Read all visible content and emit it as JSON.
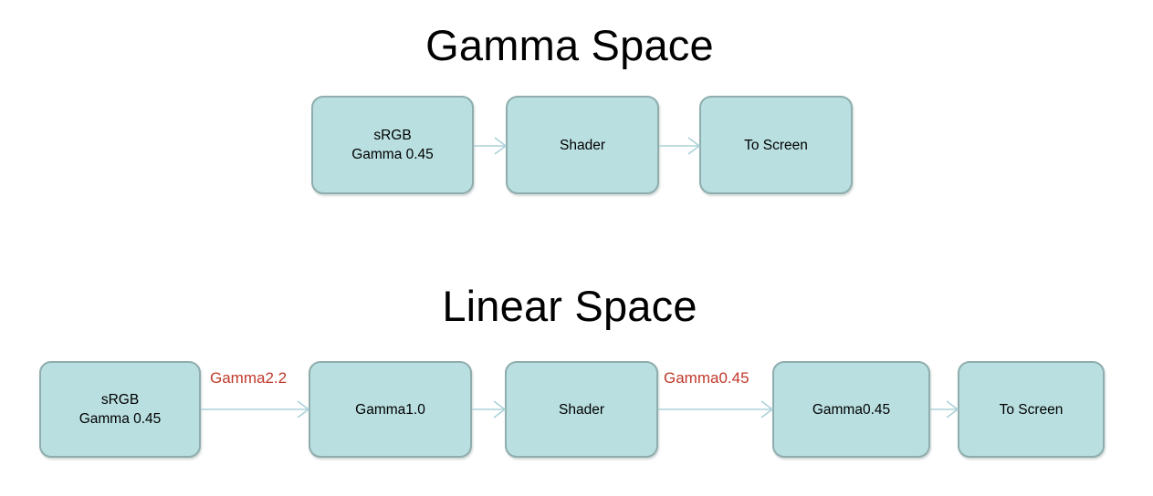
{
  "diagram": {
    "background_color": "#ffffff",
    "box_fill_color": "#b9dfe1",
    "box_border_color": "#8fadad",
    "arrow_color": "#abd2d8",
    "label_color": "#c0392b",
    "text_color": "#000000",
    "sections": [
      {
        "id": "gamma-space",
        "title": "Gamma Space",
        "nodes": [
          {
            "id": "gamma-srgb",
            "label": "sRGB\nGamma 0.45"
          },
          {
            "id": "gamma-shader",
            "label": "Shader"
          },
          {
            "id": "gamma-to-screen",
            "label": "To Screen"
          }
        ],
        "edges": [
          {
            "id": "gamma-edge-1",
            "from": "gamma-srgb",
            "to": "gamma-shader",
            "label": ""
          },
          {
            "id": "gamma-edge-2",
            "from": "gamma-shader",
            "to": "gamma-to-screen",
            "label": ""
          }
        ]
      },
      {
        "id": "linear-space",
        "title": "Linear Space",
        "nodes": [
          {
            "id": "linear-srgb",
            "label": "sRGB\nGamma 0.45"
          },
          {
            "id": "linear-gamma-1",
            "label": "Gamma1.0"
          },
          {
            "id": "linear-shader",
            "label": "Shader"
          },
          {
            "id": "linear-gamma-045",
            "label": "Gamma0.45"
          },
          {
            "id": "linear-to-screen",
            "label": "To Screen"
          }
        ],
        "edges": [
          {
            "id": "linear-edge-1",
            "from": "linear-srgb",
            "to": "linear-gamma-1",
            "label": "Gamma2.2"
          },
          {
            "id": "linear-edge-2",
            "from": "linear-gamma-1",
            "to": "linear-shader",
            "label": ""
          },
          {
            "id": "linear-edge-3",
            "from": "linear-shader",
            "to": "linear-gamma-045",
            "label": "Gamma0.45"
          },
          {
            "id": "linear-edge-4",
            "from": "linear-gamma-045",
            "to": "linear-to-screen",
            "label": ""
          }
        ]
      }
    ]
  }
}
